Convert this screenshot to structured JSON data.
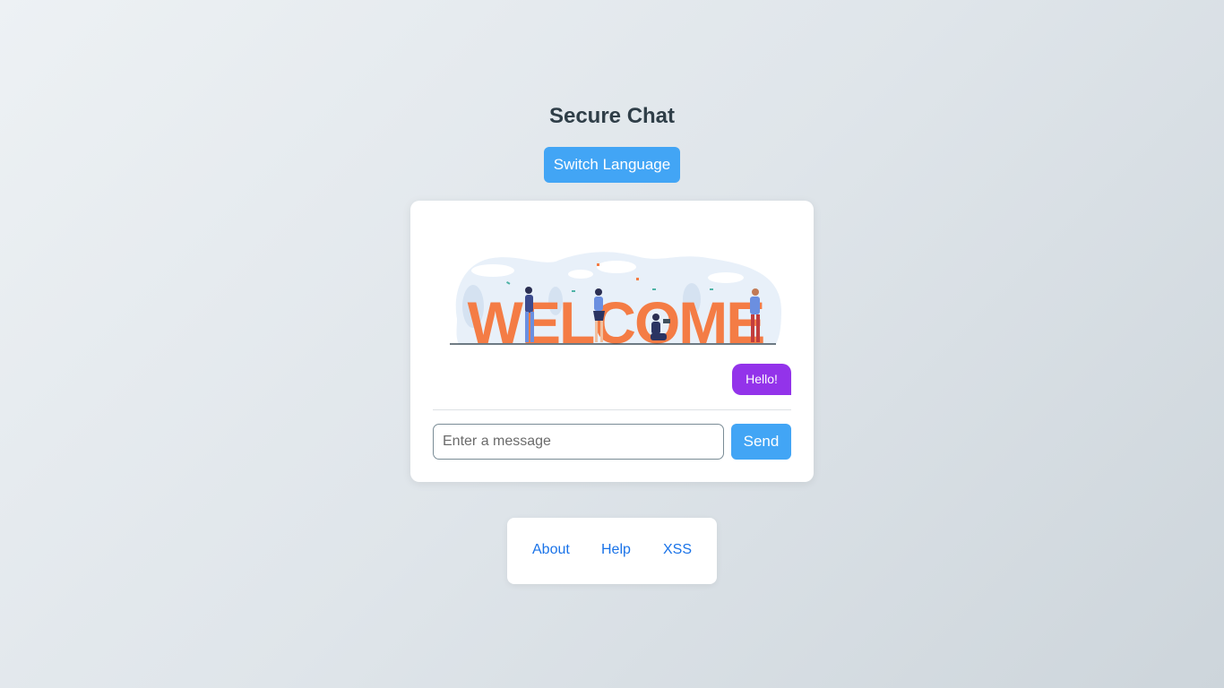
{
  "header": {
    "title": "Secure Chat",
    "switch_language_label": "Switch Language"
  },
  "chat": {
    "banner_text": "WELCOME",
    "messages": [
      {
        "text": "Hello!",
        "sender": "self"
      }
    ],
    "input": {
      "placeholder": "Enter a message",
      "value": ""
    },
    "send_label": "Send"
  },
  "footer": {
    "links": [
      {
        "label": "About"
      },
      {
        "label": "Help"
      },
      {
        "label": "XSS"
      }
    ]
  },
  "colors": {
    "accent_blue": "#42a5f5",
    "bubble_purple": "#9333ea",
    "link_blue": "#1a73e8",
    "welcome_orange": "#f47c45"
  }
}
